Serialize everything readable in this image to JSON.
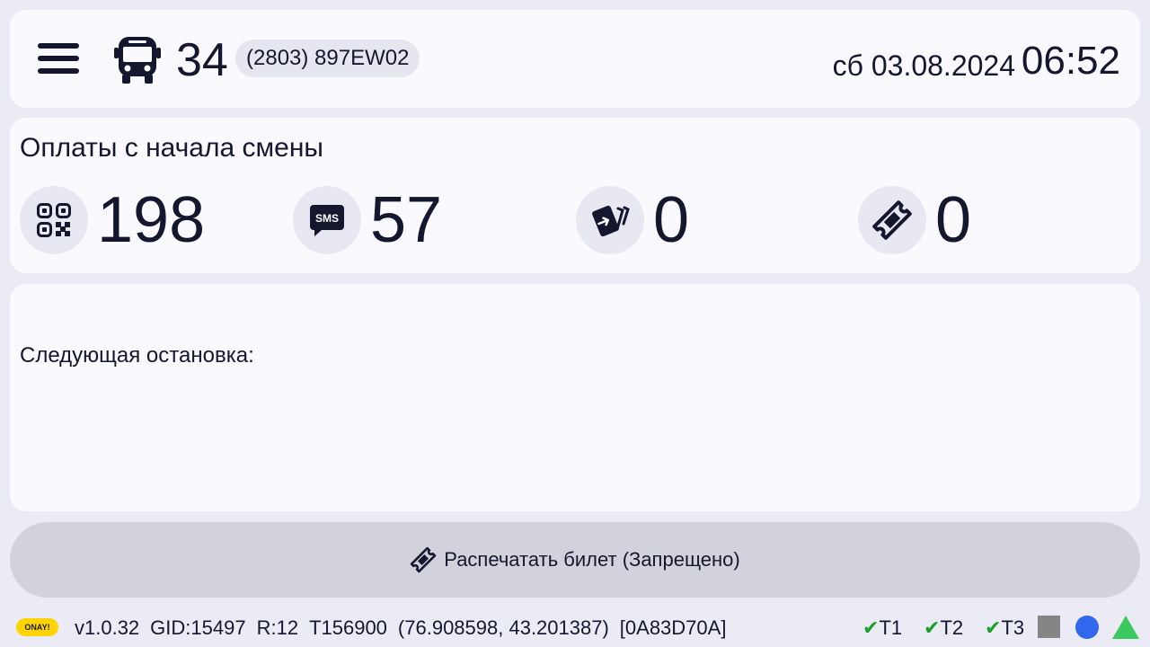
{
  "header": {
    "menu_icon": "hamburger-menu-icon",
    "bus_icon": "bus-icon",
    "route_number": "34",
    "vehicle_id": "(2803) 897EW02",
    "date": "сб 03.08.2024",
    "time": "06:52"
  },
  "payments": {
    "title": "Оплаты с начала смены",
    "stats": [
      {
        "icon": "qr-code-icon",
        "value": "198"
      },
      {
        "icon": "sms-icon",
        "value": "57"
      },
      {
        "icon": "card-tap-icon",
        "value": "0"
      },
      {
        "icon": "ticket-icon",
        "value": "0"
      }
    ]
  },
  "next_stop": {
    "label": "Следующая остановка:"
  },
  "print_button": {
    "label": "Распечатать билет (Запрещено)",
    "icon": "ticket-icon",
    "enabled": false
  },
  "status_bar": {
    "logo": "ONAY!",
    "version": "v1.0.32",
    "gid": "GID:15497",
    "r": "R:12",
    "t": "T156900",
    "coords": "(76.908598, 43.201387)",
    "hex": "[0A83D70A]",
    "indicators": [
      "T1",
      "T2",
      "T3"
    ],
    "colors": {
      "check": "#18a02a",
      "square": "#858585",
      "dot": "#3067ec",
      "triangle": "#3bc85e"
    }
  }
}
